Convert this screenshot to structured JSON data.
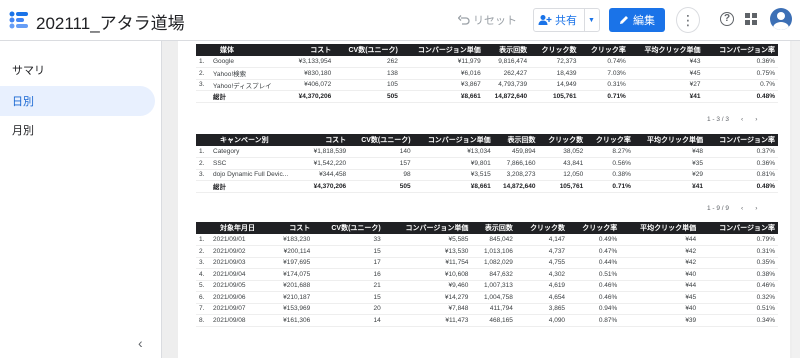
{
  "header": {
    "title": "202111_アタラ道場",
    "undo_label": "リセット",
    "share_label": "共有",
    "edit_label": "編集"
  },
  "sidebar": {
    "items": [
      {
        "label": "サマリ"
      },
      {
        "label": "日別"
      },
      {
        "label": "月別"
      }
    ]
  },
  "tables": {
    "media": {
      "headers": [
        "媒体",
        "コスト",
        "CV数(ユニーク)",
        "コンバージョン単価",
        "表示回数",
        "クリック数",
        "クリック率",
        "平均クリック単価",
        "コンバージョン率"
      ],
      "rows": [
        [
          "1.",
          "Google",
          "¥3,133,954",
          "262",
          "¥11,979",
          "9,816,474",
          "72,373",
          "0.74%",
          "¥43",
          "0.36%"
        ],
        [
          "2.",
          "Yahoo!検索",
          "¥830,180",
          "138",
          "¥6,016",
          "262,427",
          "18,439",
          "7.03%",
          "¥45",
          "0.75%"
        ],
        [
          "3.",
          "Yahoo!ディスプレイ",
          "¥406,072",
          "105",
          "¥3,867",
          "4,793,739",
          "14,949",
          "0.31%",
          "¥27",
          "0.7%"
        ]
      ],
      "total": [
        "",
        "総計",
        "¥4,370,206",
        "505",
        "¥8,661",
        "14,872,640",
        "105,761",
        "0.71%",
        "¥41",
        "0.48%"
      ],
      "pager": "1 - 3 / 3"
    },
    "campaign": {
      "headers": [
        "キャンペーン別",
        "コスト",
        "CV数(ユニーク)",
        "コンバージョン単価",
        "表示回数",
        "クリック数",
        "クリック率",
        "平均クリック単価",
        "コンバージョン率"
      ],
      "rows": [
        [
          "1.",
          "Category",
          "¥1,818,539",
          "140",
          "¥13,034",
          "459,894",
          "38,052",
          "8.27%",
          "¥48",
          "0.37%"
        ],
        [
          "2.",
          "SSC",
          "¥1,542,220",
          "157",
          "¥9,801",
          "7,866,160",
          "43,841",
          "0.56%",
          "¥35",
          "0.36%"
        ],
        [
          "3.",
          "dojo Dynamic Full Devic...",
          "¥344,458",
          "98",
          "¥3,515",
          "3,208,273",
          "12,050",
          "0.38%",
          "¥29",
          "0.81%"
        ]
      ],
      "total": [
        "",
        "総計",
        "¥4,370,206",
        "505",
        "¥8,661",
        "14,872,640",
        "105,761",
        "0.71%",
        "¥41",
        "0.48%"
      ],
      "pager": "1 - 9 / 9"
    },
    "daily": {
      "headers": [
        "対象年月日",
        "コスト",
        "CV数(ユニーク)",
        "コンバージョン単価",
        "表示回数",
        "クリック数",
        "クリック率",
        "平均クリック単価",
        "コンバージョン率"
      ],
      "rows": [
        [
          "1.",
          "2021/09/01",
          "¥183,230",
          "33",
          "¥5,585",
          "845,042",
          "4,147",
          "0.49%",
          "¥44",
          "0.79%"
        ],
        [
          "2.",
          "2021/09/02",
          "¥200,114",
          "15",
          "¥13,530",
          "1,013,106",
          "4,737",
          "0.47%",
          "¥42",
          "0.31%"
        ],
        [
          "3.",
          "2021/09/03",
          "¥197,695",
          "17",
          "¥11,754",
          "1,082,029",
          "4,755",
          "0.44%",
          "¥42",
          "0.35%"
        ],
        [
          "4.",
          "2021/09/04",
          "¥174,075",
          "16",
          "¥10,608",
          "847,632",
          "4,302",
          "0.51%",
          "¥40",
          "0.38%"
        ],
        [
          "5.",
          "2021/09/05",
          "¥201,688",
          "21",
          "¥9,460",
          "1,007,313",
          "4,619",
          "0.46%",
          "¥44",
          "0.46%"
        ],
        [
          "6.",
          "2021/09/06",
          "¥210,187",
          "15",
          "¥14,279",
          "1,004,758",
          "4,654",
          "0.46%",
          "¥45",
          "0.32%"
        ],
        [
          "7.",
          "2021/09/07",
          "¥153,969",
          "20",
          "¥7,848",
          "411,794",
          "3,865",
          "0.94%",
          "¥40",
          "0.51%"
        ],
        [
          "8.",
          "2021/09/08",
          "¥161,306",
          "14",
          "¥11,473",
          "468,165",
          "4,090",
          "0.87%",
          "¥39",
          "0.34%"
        ]
      ]
    }
  },
  "colors": {
    "accent": "#1a73e8",
    "header_bg": "#202124",
    "active_nav_bg": "#e8f0fe"
  }
}
